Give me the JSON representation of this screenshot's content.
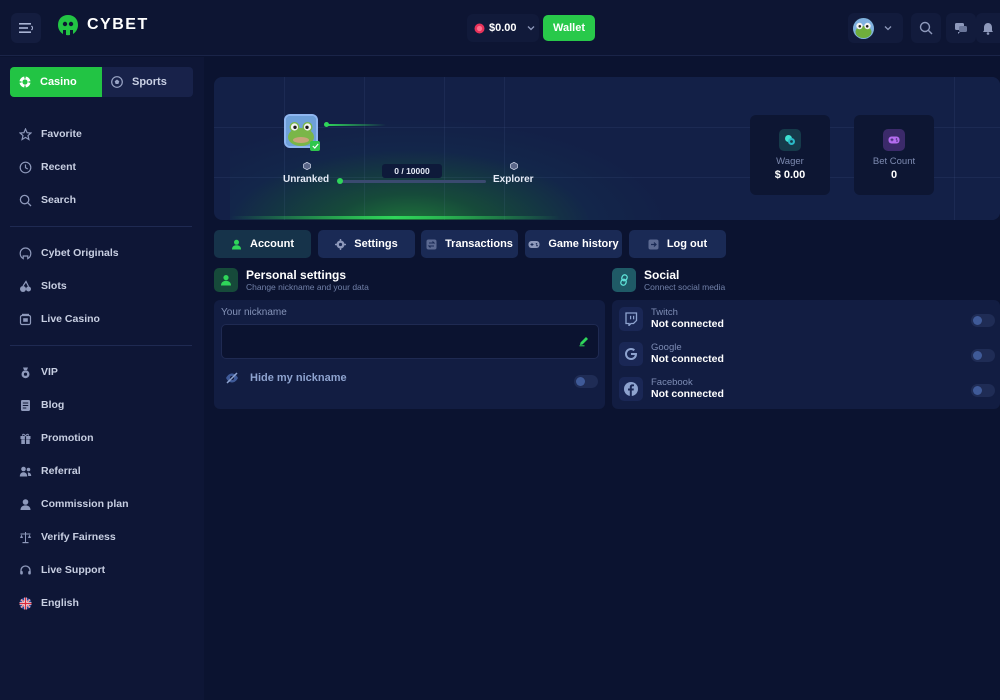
{
  "header": {
    "brand": "CYBET",
    "balance": "$0.00",
    "wallet_label": "Wallet"
  },
  "sidebar": {
    "tabs": [
      {
        "label": "Casino",
        "icon": "casino-chip-icon"
      },
      {
        "label": "Sports",
        "icon": "soccer-ball-icon"
      }
    ],
    "groups": [
      [
        {
          "label": "Favorite",
          "icon": "star-icon"
        },
        {
          "label": "Recent",
          "icon": "clock-icon"
        },
        {
          "label": "Search",
          "icon": "search-icon"
        }
      ],
      [
        {
          "label": "Cybet Originals",
          "icon": "originals-icon"
        },
        {
          "label": "Slots",
          "icon": "slots-icon"
        },
        {
          "label": "Live Casino",
          "icon": "live-casino-icon"
        }
      ],
      [
        {
          "label": "VIP",
          "icon": "vip-icon"
        },
        {
          "label": "Blog",
          "icon": "blog-icon"
        },
        {
          "label": "Promotion",
          "icon": "gift-icon"
        },
        {
          "label": "Referral",
          "icon": "referral-icon"
        },
        {
          "label": "Commission plan",
          "icon": "commission-icon"
        },
        {
          "label": "Verify Fairness",
          "icon": "scales-icon"
        },
        {
          "label": "Live Support",
          "icon": "headset-icon"
        },
        {
          "label": "English",
          "icon": "uk-flag-icon"
        }
      ]
    ]
  },
  "profile": {
    "current_rank": "Unranked",
    "next_rank": "Explorer",
    "progress_text": "0 / 10000",
    "progress_fraction": 0.0,
    "wager_label": "Wager",
    "wager_value": "$ 0.00",
    "bet_count_label": "Bet Count",
    "bet_count_value": "0"
  },
  "tabs": [
    {
      "label": "Account",
      "icon": "user-icon"
    },
    {
      "label": "Settings",
      "icon": "gear-icon"
    },
    {
      "label": "Transactions",
      "icon": "transactions-icon"
    },
    {
      "label": "Game history",
      "icon": "gamepad-icon"
    },
    {
      "label": "Log out",
      "icon": "logout-icon"
    }
  ],
  "personal": {
    "title": "Personal settings",
    "subtitle": "Change nickname and your data",
    "nickname_label": "Your nickname",
    "nickname_value": "",
    "hide_label": "Hide my nickname",
    "hide_enabled": false
  },
  "social": {
    "title": "Social",
    "subtitle": "Connect social media",
    "items": [
      {
        "name": "Twitch",
        "status": "Not connected",
        "icon": "twitch-icon",
        "enabled": false
      },
      {
        "name": "Google",
        "status": "Not connected",
        "icon": "google-icon",
        "enabled": false
      },
      {
        "name": "Facebook",
        "status": "Not connected",
        "icon": "facebook-icon",
        "enabled": false
      }
    ]
  },
  "colors": {
    "accent": "#22c444",
    "background": "#0b1330",
    "sidebar": "#0e1636",
    "panel": "#121d42"
  }
}
